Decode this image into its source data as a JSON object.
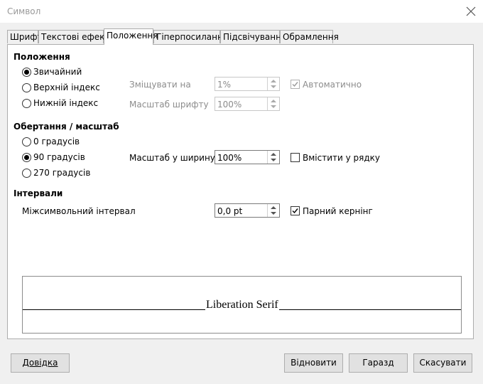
{
  "window": {
    "title": "Символ"
  },
  "tabs": [
    {
      "label": "Шрифт"
    },
    {
      "label": "Текстові ефекти"
    },
    {
      "label": "Положення"
    },
    {
      "label": "Гіперпосилання"
    },
    {
      "label": "Підсвічування"
    },
    {
      "label": "Обрамлення"
    }
  ],
  "position": {
    "heading": "Положення",
    "normal": "Звичайний",
    "superscript": "Верхній індекс",
    "subscript": "Нижній індекс",
    "raise_label": "Зміщувати на",
    "raise_value": "1%",
    "automatic": "Автоматично",
    "relsize_label": "Масштаб шрифту",
    "relsize_value": "100%"
  },
  "rotation": {
    "heading": "Обертання / масштаб",
    "deg0": "0 градусів",
    "deg90": "90 градусів",
    "deg270": "270 градусів",
    "scale_label": "Масштаб у ширину",
    "scale_value": "100%",
    "fit_line": "Вмістити у рядку"
  },
  "spacing": {
    "heading": "Інтервали",
    "char_spacing_label": "Міжсимвольний інтервал",
    "char_spacing_value": "0,0 pt",
    "pair_kerning": "Парний кернінг"
  },
  "preview": {
    "text": "Liberation Serif"
  },
  "buttons": {
    "help": "Довідка",
    "reset": "Відновити",
    "ok": "Гаразд",
    "cancel": "Скасувати"
  }
}
